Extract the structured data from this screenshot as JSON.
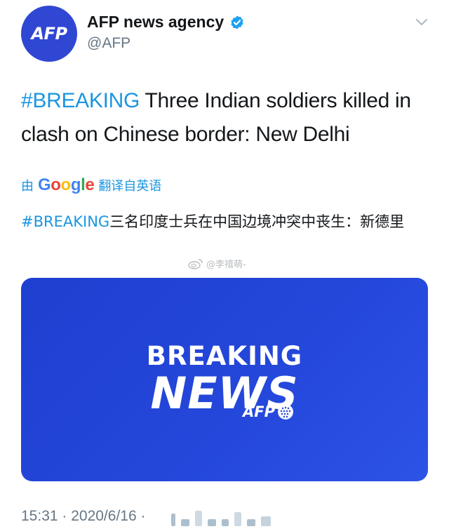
{
  "account": {
    "avatar_text": "AFP",
    "display_name": "AFP news agency",
    "handle": "@AFP",
    "verified": true
  },
  "tweet": {
    "hashtag": "#BREAKING",
    "text": " Three Indian soldiers killed in clash on Chinese border: New Delhi"
  },
  "translation": {
    "prefix": "由",
    "provider": "Google",
    "suffix": "翻译自英语",
    "hashtag": "#BREAKING",
    "text": "三名印度士兵在中国边境冲突中丧生：新德里"
  },
  "watermark": {
    "text": "@李禧萌-"
  },
  "media": {
    "line1": "BREAKING",
    "line2": "NEWS",
    "brand": "AFP"
  },
  "footer": {
    "timestamp": "15:31 · 2020/6/16 ·"
  },
  "colors": {
    "brand_blue": "#2f47d3",
    "hashtag_blue": "#1b95e0",
    "verified_blue": "#1da1f2"
  }
}
